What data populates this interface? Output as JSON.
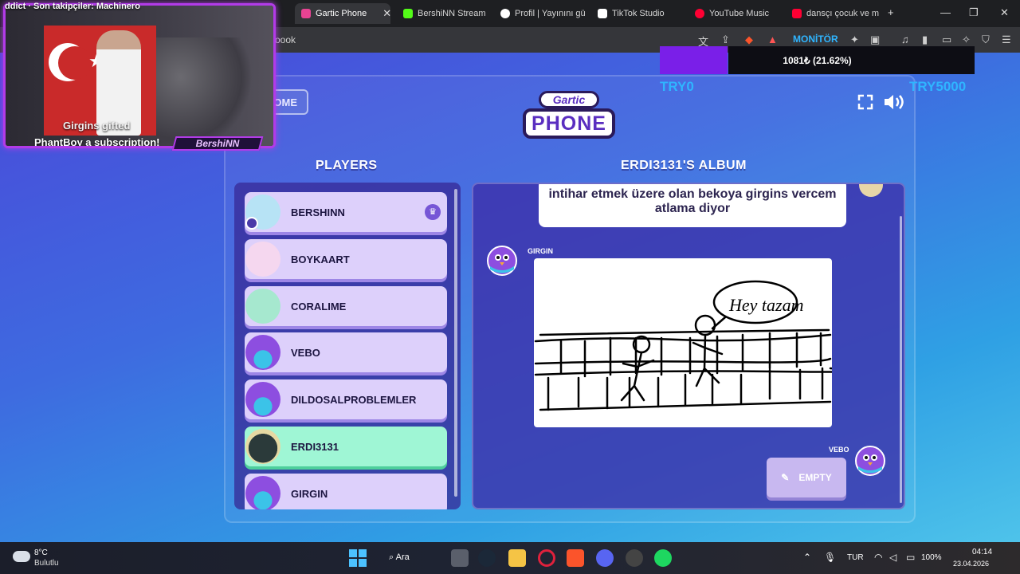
{
  "browser": {
    "tabs": [
      {
        "label": "Gartic Phone",
        "active": true,
        "color": "#e84393"
      },
      {
        "label": "BershiNN Stream",
        "active": false,
        "color": "#53fc18"
      },
      {
        "label": "Profil | Yayınını gü",
        "active": false,
        "color": "#ffffff"
      },
      {
        "label": "TikTok Studio",
        "active": false,
        "color": "#ffffff"
      },
      {
        "label": "YouTube Music",
        "active": false,
        "color": "#ff0033"
      },
      {
        "label": "dansçı çocuk ve m",
        "active": false,
        "color": "#ff0033"
      }
    ],
    "address_fragment": "oook",
    "monitor_label": "MONİTÖR"
  },
  "stream": {
    "ticker": "ddict · Son takipçiler: Machinero",
    "alert_line1": "Girgins gifted",
    "alert_line2": "PhantBoy a subscription!",
    "name_tag": "BershiNN",
    "donation_text": "1081₺ (21.62%)",
    "donation_progress": 0.2162,
    "goal_start": "TRY0",
    "goal_end": "TRY5000"
  },
  "game": {
    "home_label": "OME",
    "logo_top": "Gartic",
    "logo_bottom": "PHONE",
    "players_title": "PLAYERS",
    "album_title": "ERDI3131'S ALBUM",
    "players": [
      {
        "name": "BERSHINN",
        "host": true,
        "highlight": false,
        "avatar_color": "#b7e3f5"
      },
      {
        "name": "BOYKAART",
        "host": false,
        "highlight": false,
        "avatar_color": "#f5d7ef"
      },
      {
        "name": "CORALIME",
        "host": false,
        "highlight": false,
        "avatar_color": "#a6e8cf"
      },
      {
        "name": "VEBO",
        "host": false,
        "highlight": false,
        "avatar_color": "#8d4ee0"
      },
      {
        "name": "DILDOSALPROBLEMLER",
        "host": false,
        "highlight": false,
        "avatar_color": "#8d4ee0"
      },
      {
        "name": "ERDI3131",
        "host": false,
        "highlight": true,
        "avatar_color": "#2b3a3a"
      },
      {
        "name": "GIRGIN",
        "host": false,
        "highlight": false,
        "avatar_color": "#8d4ee0"
      }
    ],
    "album": {
      "caption": "intihar etmek üzere olan bekoya girgins vercem atlama diyor",
      "drawing_author": "GIRGIN",
      "speech_text": "Hey tazam",
      "next_author": "VEBO",
      "empty_label": "EMPTY"
    }
  },
  "taskbar": {
    "weather_temp": "8°C",
    "weather_desc": "Bulutlu",
    "search_label": "Ara",
    "language": "TUR",
    "battery": "100%",
    "time": "04:14",
    "date": "23.04.2026"
  }
}
